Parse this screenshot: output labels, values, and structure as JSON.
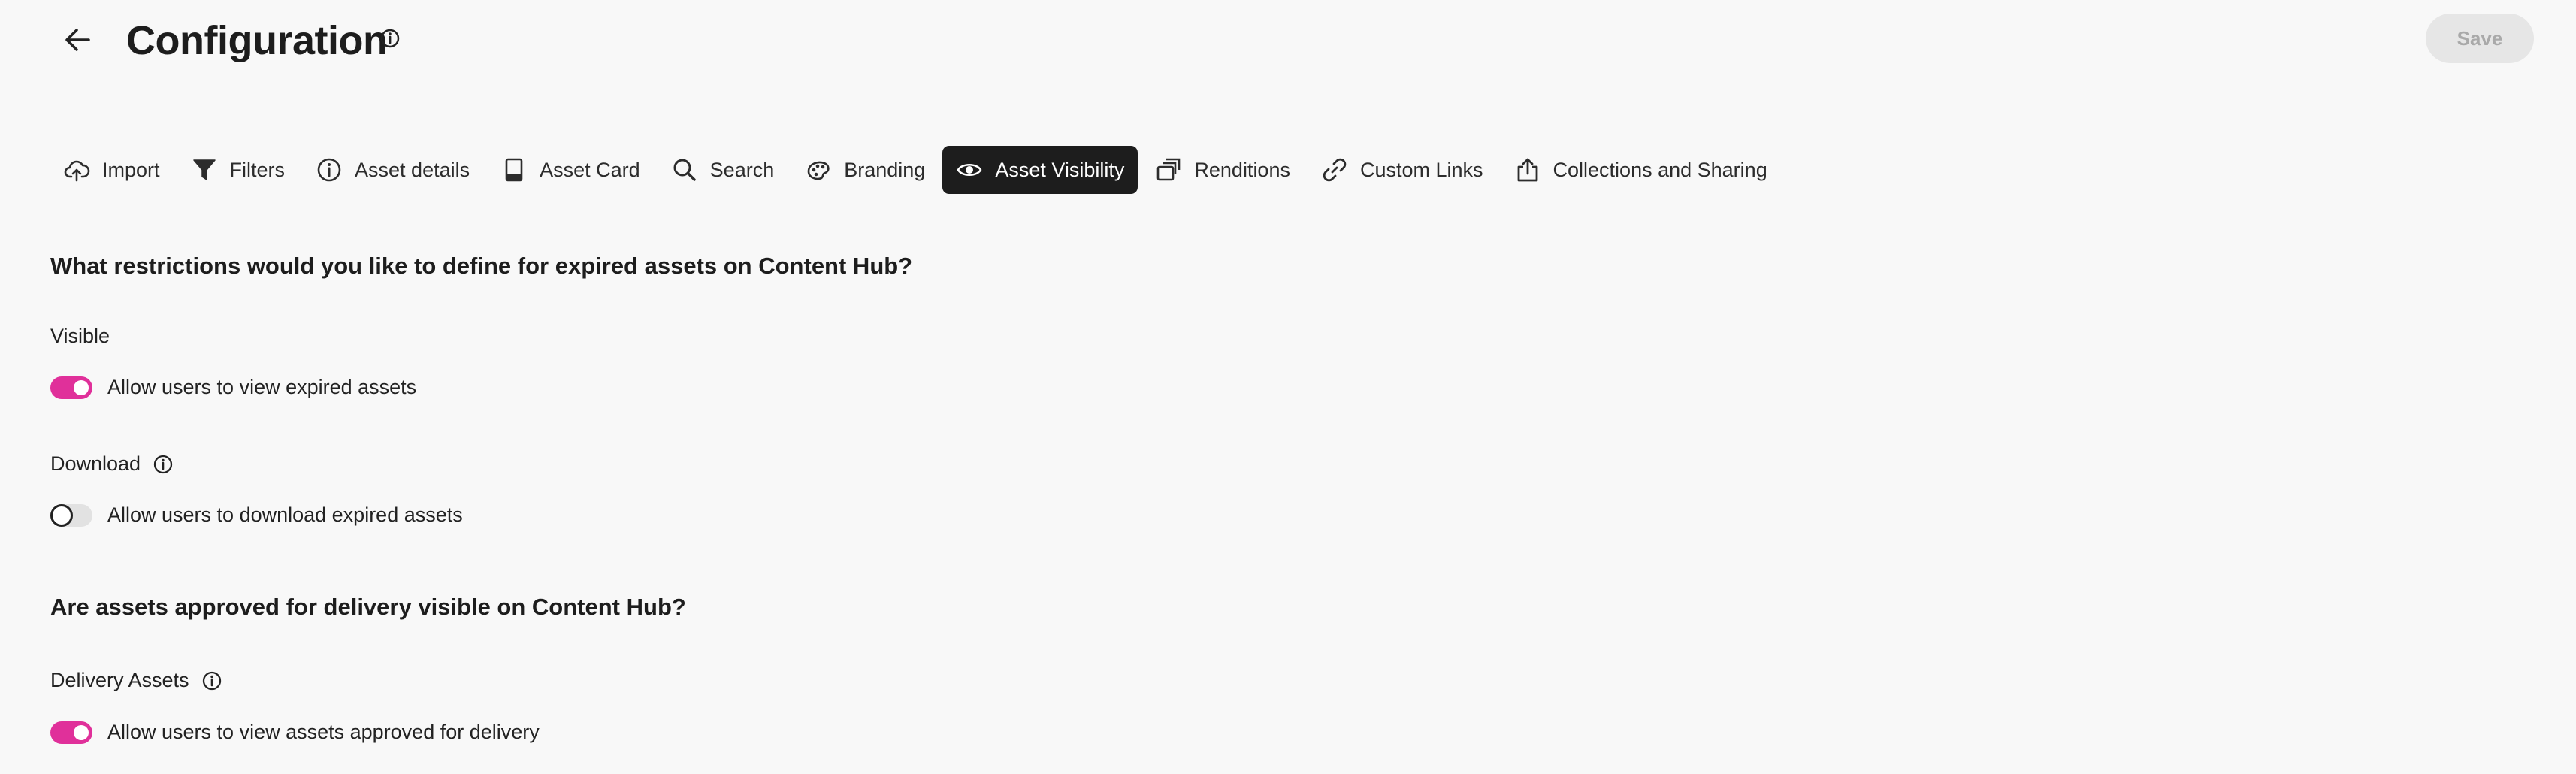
{
  "header": {
    "title": "Configuration",
    "save_label": "Save"
  },
  "tabs": [
    {
      "label": "Import",
      "icon": "upload-cloud-icon",
      "active": false
    },
    {
      "label": "Filters",
      "icon": "filter-icon",
      "active": false
    },
    {
      "label": "Asset details",
      "icon": "info-icon",
      "active": false
    },
    {
      "label": "Asset Card",
      "icon": "card-icon",
      "active": false
    },
    {
      "label": "Search",
      "icon": "search-icon",
      "active": false
    },
    {
      "label": "Branding",
      "icon": "palette-icon",
      "active": false
    },
    {
      "label": "Asset Visibility",
      "icon": "eye-icon",
      "active": true
    },
    {
      "label": "Renditions",
      "icon": "renditions-icon",
      "active": false
    },
    {
      "label": "Custom Links",
      "icon": "link-icon",
      "active": false
    },
    {
      "label": "Collections and Sharing",
      "icon": "share-icon",
      "active": false
    }
  ],
  "sections": {
    "expired": {
      "title": "What restrictions would you like to define for expired assets on Content Hub?",
      "visible": {
        "label": "Visible",
        "toggle_label": "Allow users to view expired assets",
        "enabled": true
      },
      "download": {
        "label": "Download",
        "toggle_label": "Allow users to download expired assets",
        "enabled": false
      }
    },
    "delivery": {
      "title": "Are assets approved for delivery visible on Content Hub?",
      "delivery_assets": {
        "label": "Delivery Assets",
        "toggle_label": "Allow users to view assets approved for delivery",
        "enabled": true
      }
    }
  },
  "colors": {
    "accent": "#e0309a",
    "active_tab_bg": "#1d1d1d",
    "background": "#f8f8f8",
    "save_disabled_bg": "#e6e6e6"
  }
}
